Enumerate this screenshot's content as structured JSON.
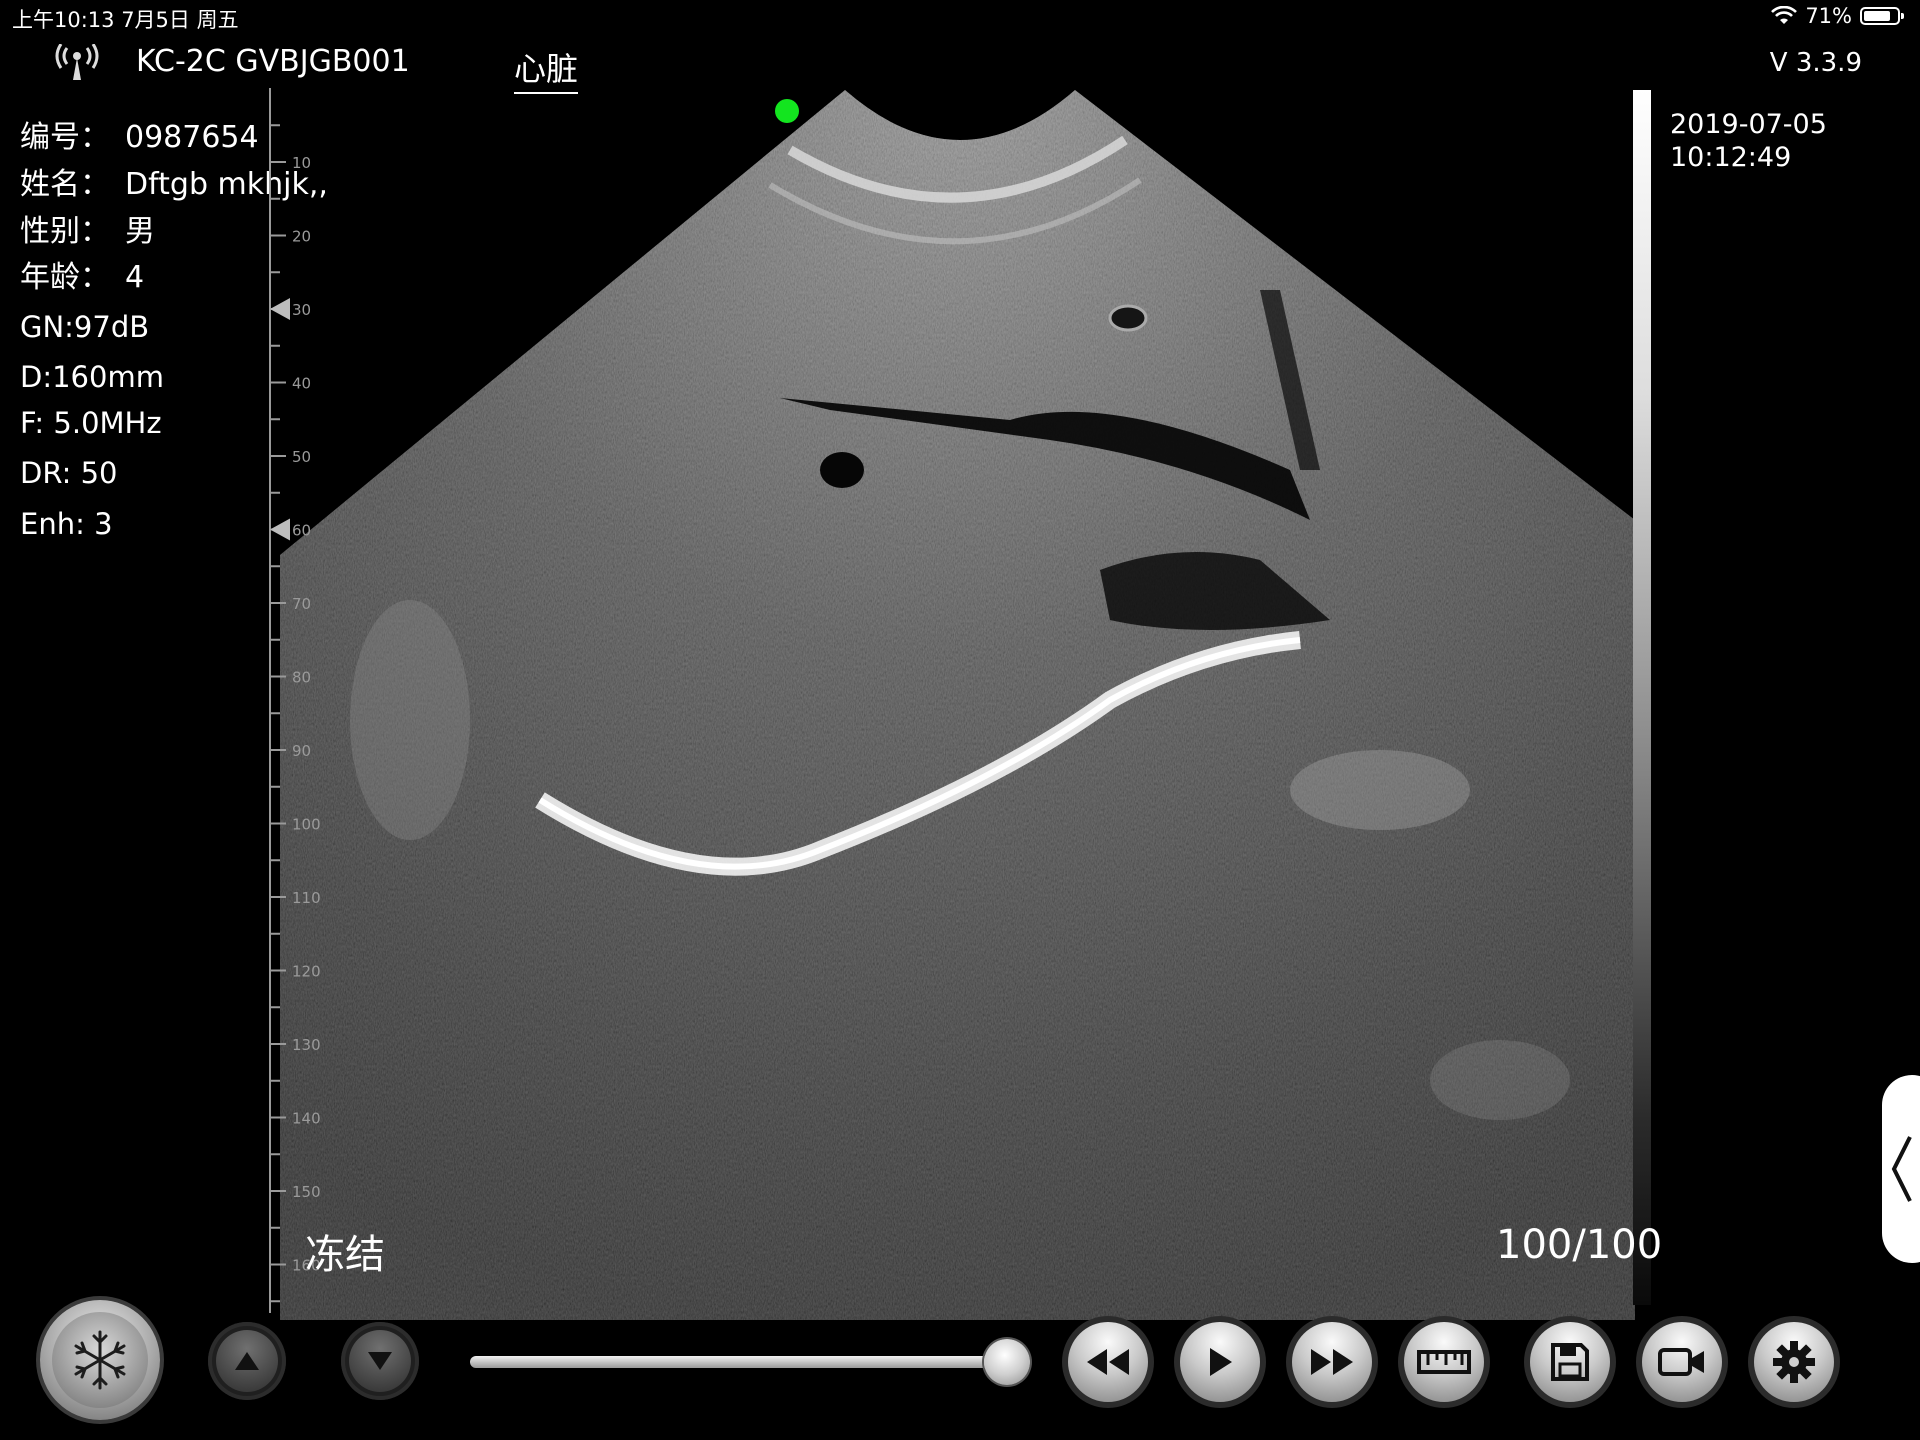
{
  "status_bar": {
    "time_date": "上午10:13  7月5日 周五",
    "battery": "71%",
    "battery_level": 0.71
  },
  "header": {
    "device_name": "KC-2C GVBJGB001",
    "mode_tab": "心脏",
    "version": "V 3.3.9"
  },
  "patient": [
    {
      "label": "编号：",
      "value": "0987654"
    },
    {
      "label": "姓名：",
      "value": "Dftgb mkhjk,,"
    },
    {
      "label": "性别：",
      "value": "男"
    },
    {
      "label": "年龄：",
      "value": "4"
    }
  ],
  "params": {
    "gain": "GN:97dB",
    "depth": "D:160mm",
    "frequency": "F: 5.0MHz",
    "dynamic_range": "DR: 50",
    "enhance": "Enh: 3"
  },
  "ruler": {
    "ticks": [
      "10",
      "20",
      "30",
      "40",
      "50",
      "60",
      "70",
      "80",
      "90",
      "100",
      "110",
      "120",
      "130",
      "140",
      "150",
      "160"
    ],
    "focus_markers": [
      30,
      60
    ]
  },
  "datetime": {
    "date": "2019-07-05",
    "time": "10:12:49"
  },
  "freeze_label": "冻结",
  "frame_count": "100/100",
  "cine_slider": {
    "position": 1.0
  },
  "colors": {
    "indicator_dot": "#13e51f"
  },
  "controls": {
    "freeze": "snowflake-icon",
    "up": "triangle-up-icon",
    "down": "triangle-down-icon",
    "rewind": "rewind-icon",
    "play": "play-icon",
    "fast_forward": "fast-forward-icon",
    "measure": "ruler-icon",
    "save": "save-icon",
    "record": "video-camera-icon",
    "settings": "gear-icon"
  }
}
